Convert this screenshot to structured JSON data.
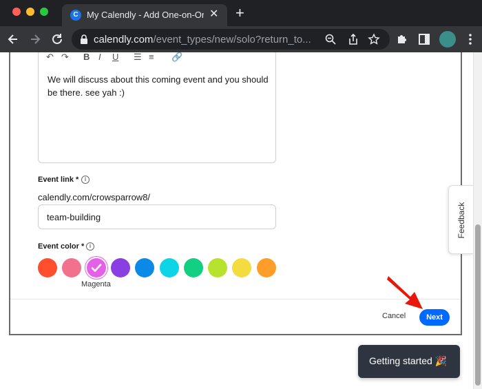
{
  "browser": {
    "tab_title": "My Calendly - Add One-on-One",
    "tab_favicon_letter": "C",
    "url_domain": "calendly.com",
    "url_path": "/event_types/new/solo?return_to..."
  },
  "editor": {
    "description": "We will discuss about this coming event and you should be there. see yah :)",
    "tools": [
      "undo-icon",
      "redo-icon",
      "bold-icon",
      "italic-icon",
      "underline-icon",
      "bullet-list-icon",
      "numbered-list-icon",
      "link-icon"
    ]
  },
  "event_link": {
    "label": "Event link *",
    "prefix": "calendly.com/crowsparrow8/",
    "value": "team-building"
  },
  "event_color": {
    "label": "Event color *",
    "selected_name": "Magenta",
    "swatches": [
      "#ff4f2f",
      "#f2718d",
      "#e560e8",
      "#8a3fe2",
      "#0a8ae6",
      "#0dd4e6",
      "#12cf82",
      "#b7e22e",
      "#f4db3f",
      "#ff9d2a"
    ],
    "selected_index": 2
  },
  "actions": {
    "cancel_label": "Cancel",
    "next_label": "Next"
  },
  "feedback": {
    "label": "Feedback"
  },
  "toast": {
    "text": "Getting started 🎉"
  }
}
